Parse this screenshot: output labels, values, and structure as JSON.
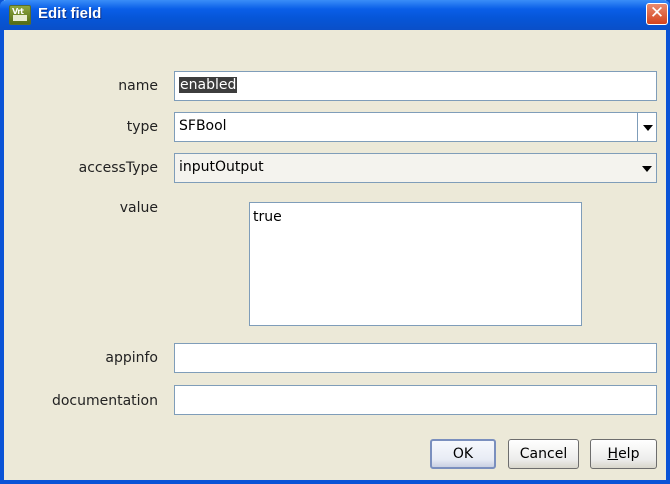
{
  "window": {
    "title": "Edit field",
    "app_icon_text": "Vrt",
    "close_glyph": "✕"
  },
  "form": {
    "name_label": "name",
    "name_value": "enabled",
    "type_label": "type",
    "type_value": "SFBool",
    "access_label": "accessType",
    "access_value": "inputOutput",
    "value_label": "value",
    "value_text": "true",
    "appinfo_label": "appinfo",
    "appinfo_value": "",
    "documentation_label": "documentation",
    "documentation_value": ""
  },
  "buttons": {
    "ok": "OK",
    "cancel": "Cancel",
    "help_mnemonic": "H",
    "help_rest": "elp"
  },
  "colors": {
    "titlebar": "#0a5fe8",
    "dialog_bg": "#ece9d8",
    "close": "#d5431d",
    "selection": "#3d3d3d"
  }
}
